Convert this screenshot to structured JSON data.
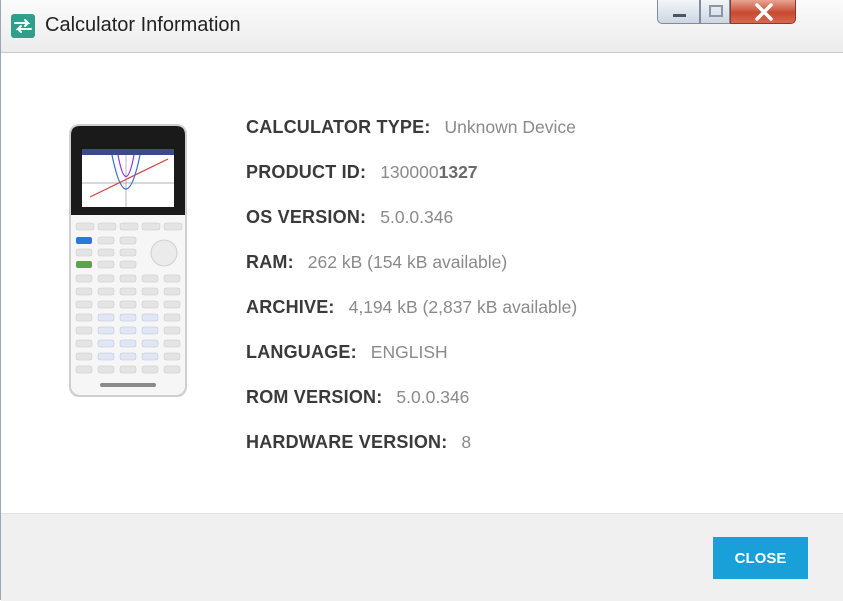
{
  "window": {
    "title": "Calculator Information"
  },
  "info": {
    "calculator_type": {
      "label": "CALCULATOR TYPE:",
      "value": "Unknown Device"
    },
    "product_id": {
      "label": "PRODUCT ID:",
      "value_prefix": "130000",
      "value_bold": "1327"
    },
    "os_version": {
      "label": "OS VERSION:",
      "value": "5.0.0.346"
    },
    "ram": {
      "label": "RAM:",
      "value": "262 kB (154 kB available)"
    },
    "archive": {
      "label": "ARCHIVE:",
      "value": "4,194 kB (2,837 kB available)"
    },
    "language": {
      "label": "LANGUAGE:",
      "value": "ENGLISH"
    },
    "rom_version": {
      "label": "ROM VERSION:",
      "value": "5.0.0.346"
    },
    "hardware_version": {
      "label": "HARDWARE VERSION:",
      "value": "8"
    }
  },
  "footer": {
    "close_label": "CLOSE"
  },
  "colors": {
    "accent": "#1aa0d8",
    "label": "#3a3a3a",
    "value": "#8a8a8a"
  }
}
